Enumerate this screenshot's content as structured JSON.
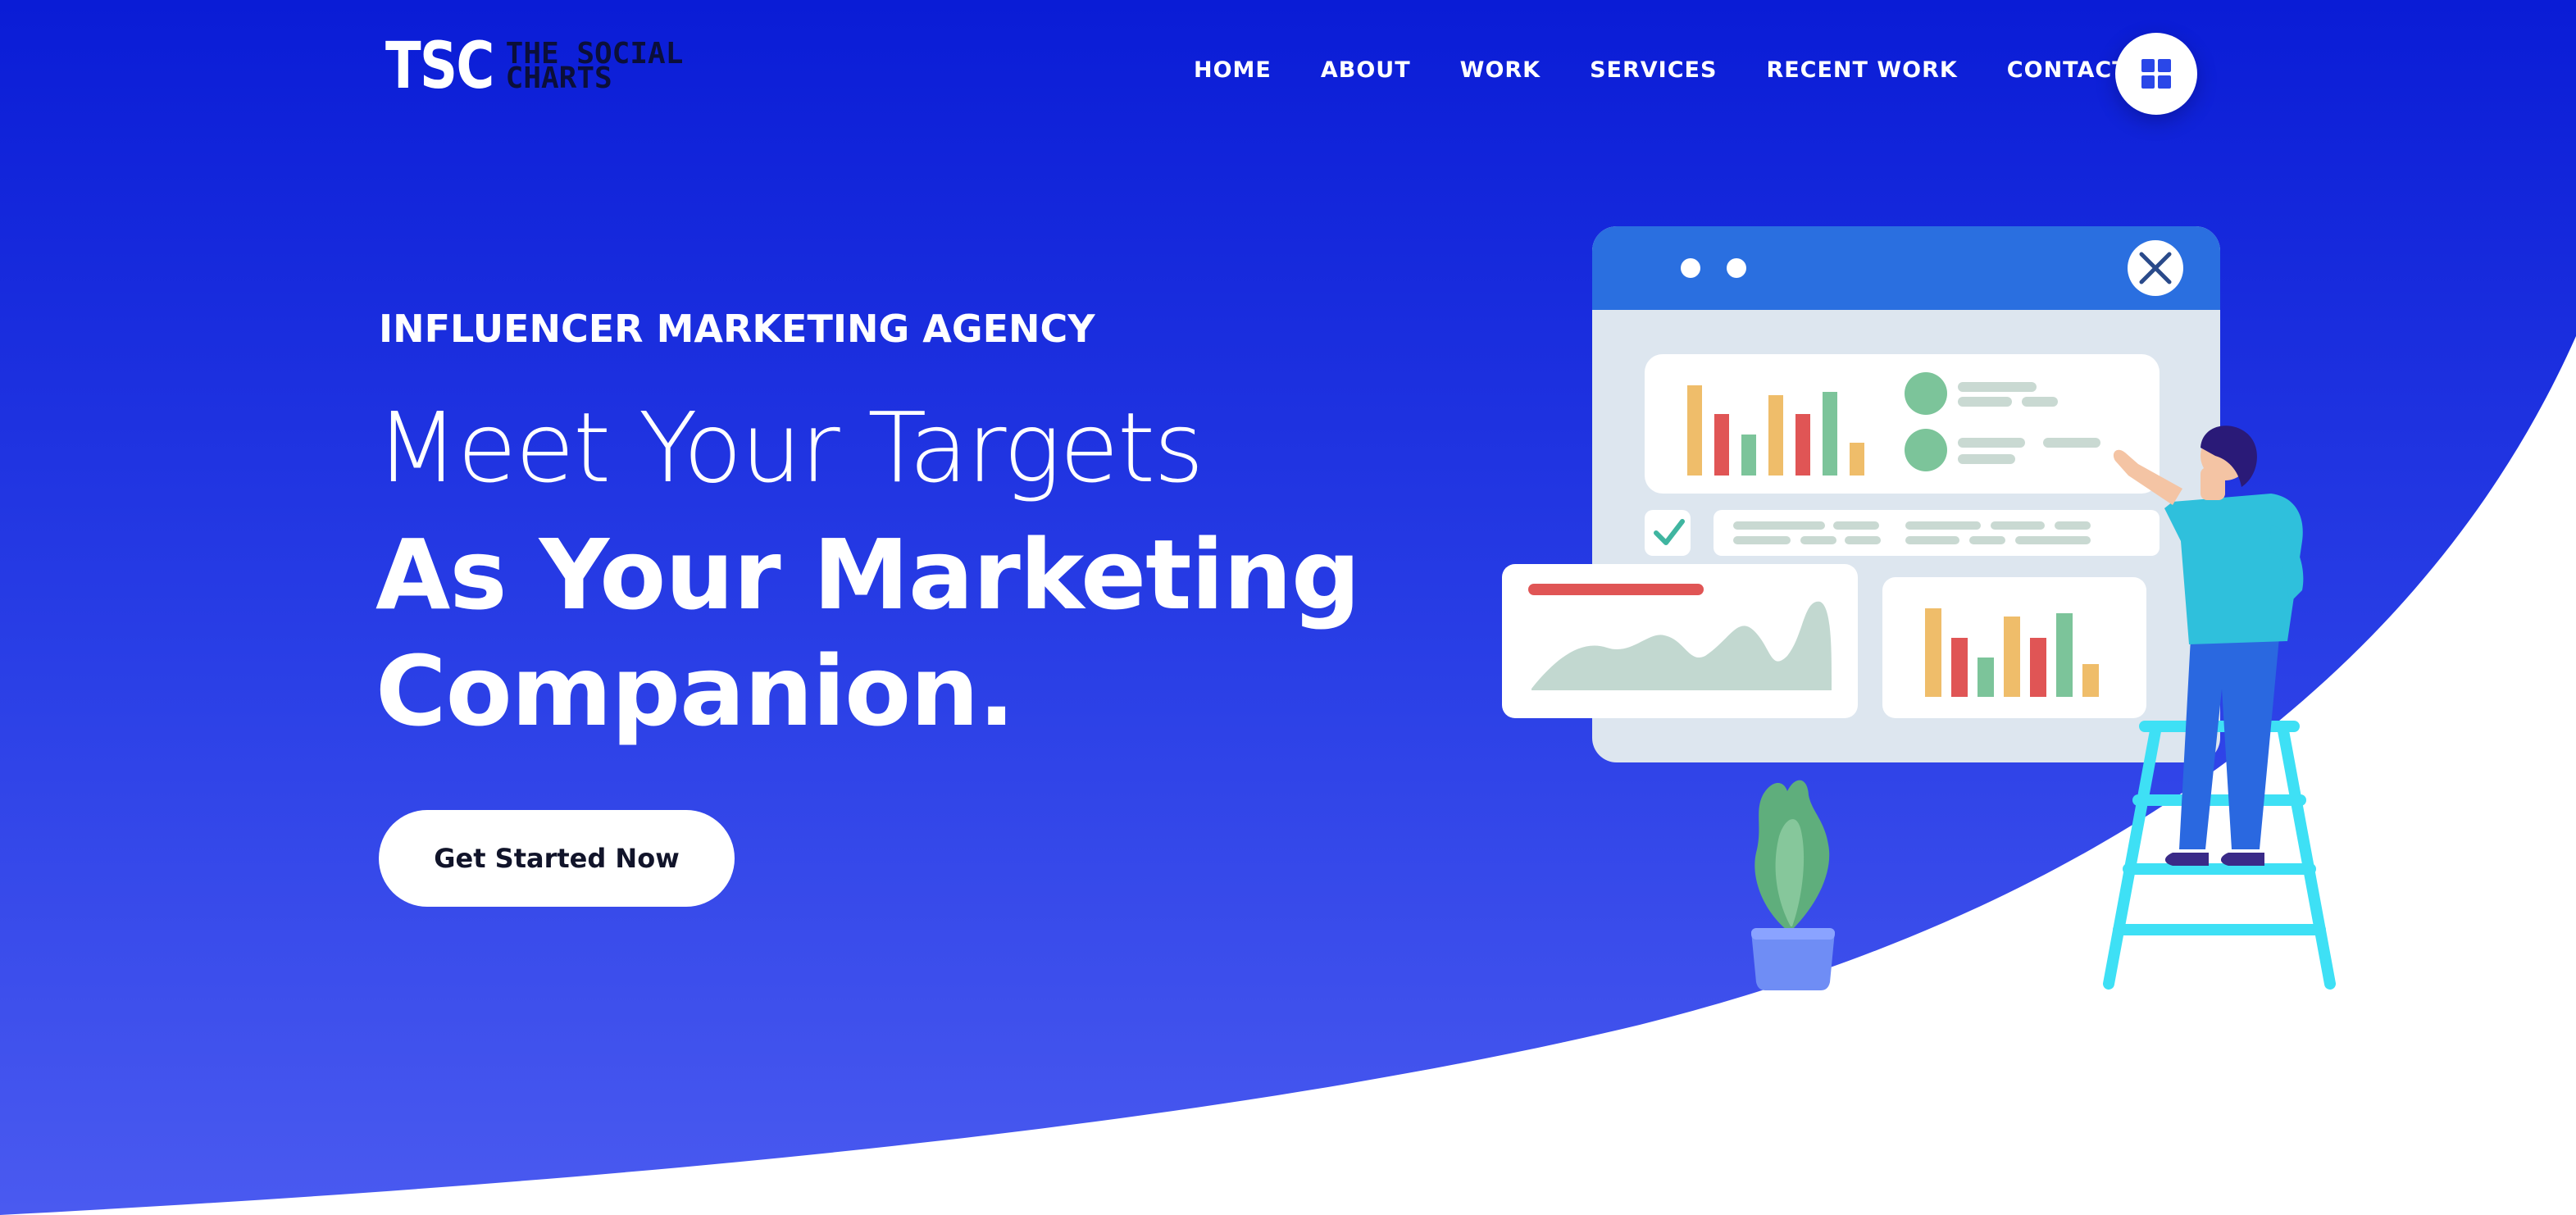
{
  "brand": {
    "logo_mark": "TSC",
    "logo_line1": "THE SOCIAL",
    "logo_line2": "CHARTS"
  },
  "nav": {
    "items": [
      {
        "label": "HOME"
      },
      {
        "label": "ABOUT"
      },
      {
        "label": "WORK"
      },
      {
        "label": "SERVICES"
      },
      {
        "label": "RECENT WORK"
      },
      {
        "label": "CONTACT"
      }
    ],
    "menu_icon": "grid-icon"
  },
  "hero": {
    "eyebrow": "INFLUENCER MARKETING AGENCY",
    "headline_light": "Meet Your Targets",
    "headline_bold_1": "As Your Marketing",
    "headline_bold_2": "Companion.",
    "cta_label": "Get Started Now"
  },
  "illustration": {
    "subject": "person-on-ladder-pointing-at-dashboard",
    "icons": [
      "close-icon",
      "check-icon",
      "plant-icon"
    ]
  },
  "colors": {
    "hero_top": "#0a1cd6",
    "hero_bottom": "#4a5af0",
    "text_white": "#ffffff",
    "logo_dark": "#0b0f3a",
    "bar_yellow": "#efbd6a",
    "bar_red": "#e05555",
    "bar_green": "#7cc49a",
    "window_blue": "#2a6fe0",
    "ladder_cyan": "#3ee0f5"
  }
}
